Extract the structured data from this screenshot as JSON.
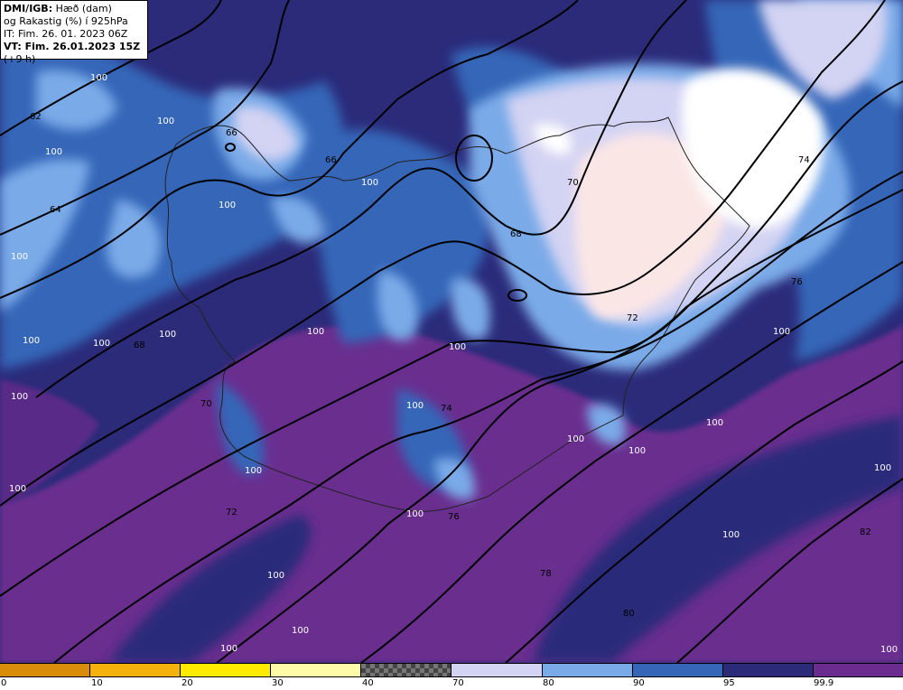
{
  "header": {
    "line1_bold": "DMI/IGB:",
    "line1_rest": " Hæð (dam)",
    "line2": "og Rakastig (%) í 925hPa",
    "line3": "IT: Fim. 26. 01. 2023 06Z",
    "line4_bold": "VT: Fim. 26.01.2023 15Z",
    "line4_rest": " (+9 h)"
  },
  "colorbar": {
    "segments": [
      {
        "color": "#d98c0a",
        "pattern": "solid"
      },
      {
        "color": "#f5b10c",
        "pattern": "solid"
      },
      {
        "color": "#ffea00",
        "pattern": "solid"
      },
      {
        "color": "#fefba8",
        "pattern": "solid"
      },
      {
        "color": "#777777",
        "pattern": "checker"
      },
      {
        "color": "#d3d3f3",
        "pattern": "solid"
      },
      {
        "color": "#7aaae8",
        "pattern": "solid"
      },
      {
        "color": "#3566b8",
        "pattern": "solid"
      },
      {
        "color": "#2b2b7a",
        "pattern": "solid"
      },
      {
        "color": "#6a2d8f",
        "pattern": "solid"
      }
    ],
    "ticks": [
      "0",
      "10",
      "20",
      "30",
      "40",
      "70",
      "80",
      "90",
      "95",
      "99.9"
    ]
  },
  "contour_labels": [
    "62",
    "64",
    "66",
    "66",
    "68",
    "68",
    "70",
    "70",
    "72",
    "72",
    "74",
    "74",
    "76",
    "76",
    "78",
    "80",
    "82"
  ],
  "rh_labels": [
    "100",
    "100",
    "100",
    "100",
    "100",
    "100",
    "100",
    "100",
    "100",
    "100",
    "100",
    "100",
    "100",
    "100",
    "100",
    "100",
    "100",
    "100",
    "100",
    "100",
    "100",
    "100",
    "100",
    "100",
    "100",
    "100"
  ]
}
